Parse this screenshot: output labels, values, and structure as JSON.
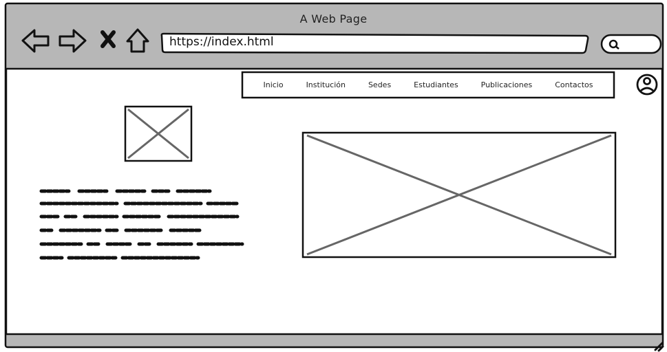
{
  "window": {
    "title": "A Web Page"
  },
  "address_bar": {
    "url": "https://index.html"
  },
  "nav": {
    "items": [
      {
        "label": "Inicio"
      },
      {
        "label": "Institución"
      },
      {
        "label": "Sedes"
      },
      {
        "label": "Estudiantes"
      },
      {
        "label": "Publicaciones"
      },
      {
        "label": "Contactos"
      }
    ]
  },
  "icons": {
    "back": "back-arrow-icon",
    "forward": "forward-arrow-icon",
    "stop": "close-icon",
    "home": "home-icon",
    "search": "search-icon",
    "user": "user-icon",
    "resize": "resize-grip-icon"
  },
  "colors": {
    "chrome": "#b7b7b7",
    "content": "#ffffff",
    "stroke": "#111111",
    "placeholder_stroke": "#666666"
  }
}
